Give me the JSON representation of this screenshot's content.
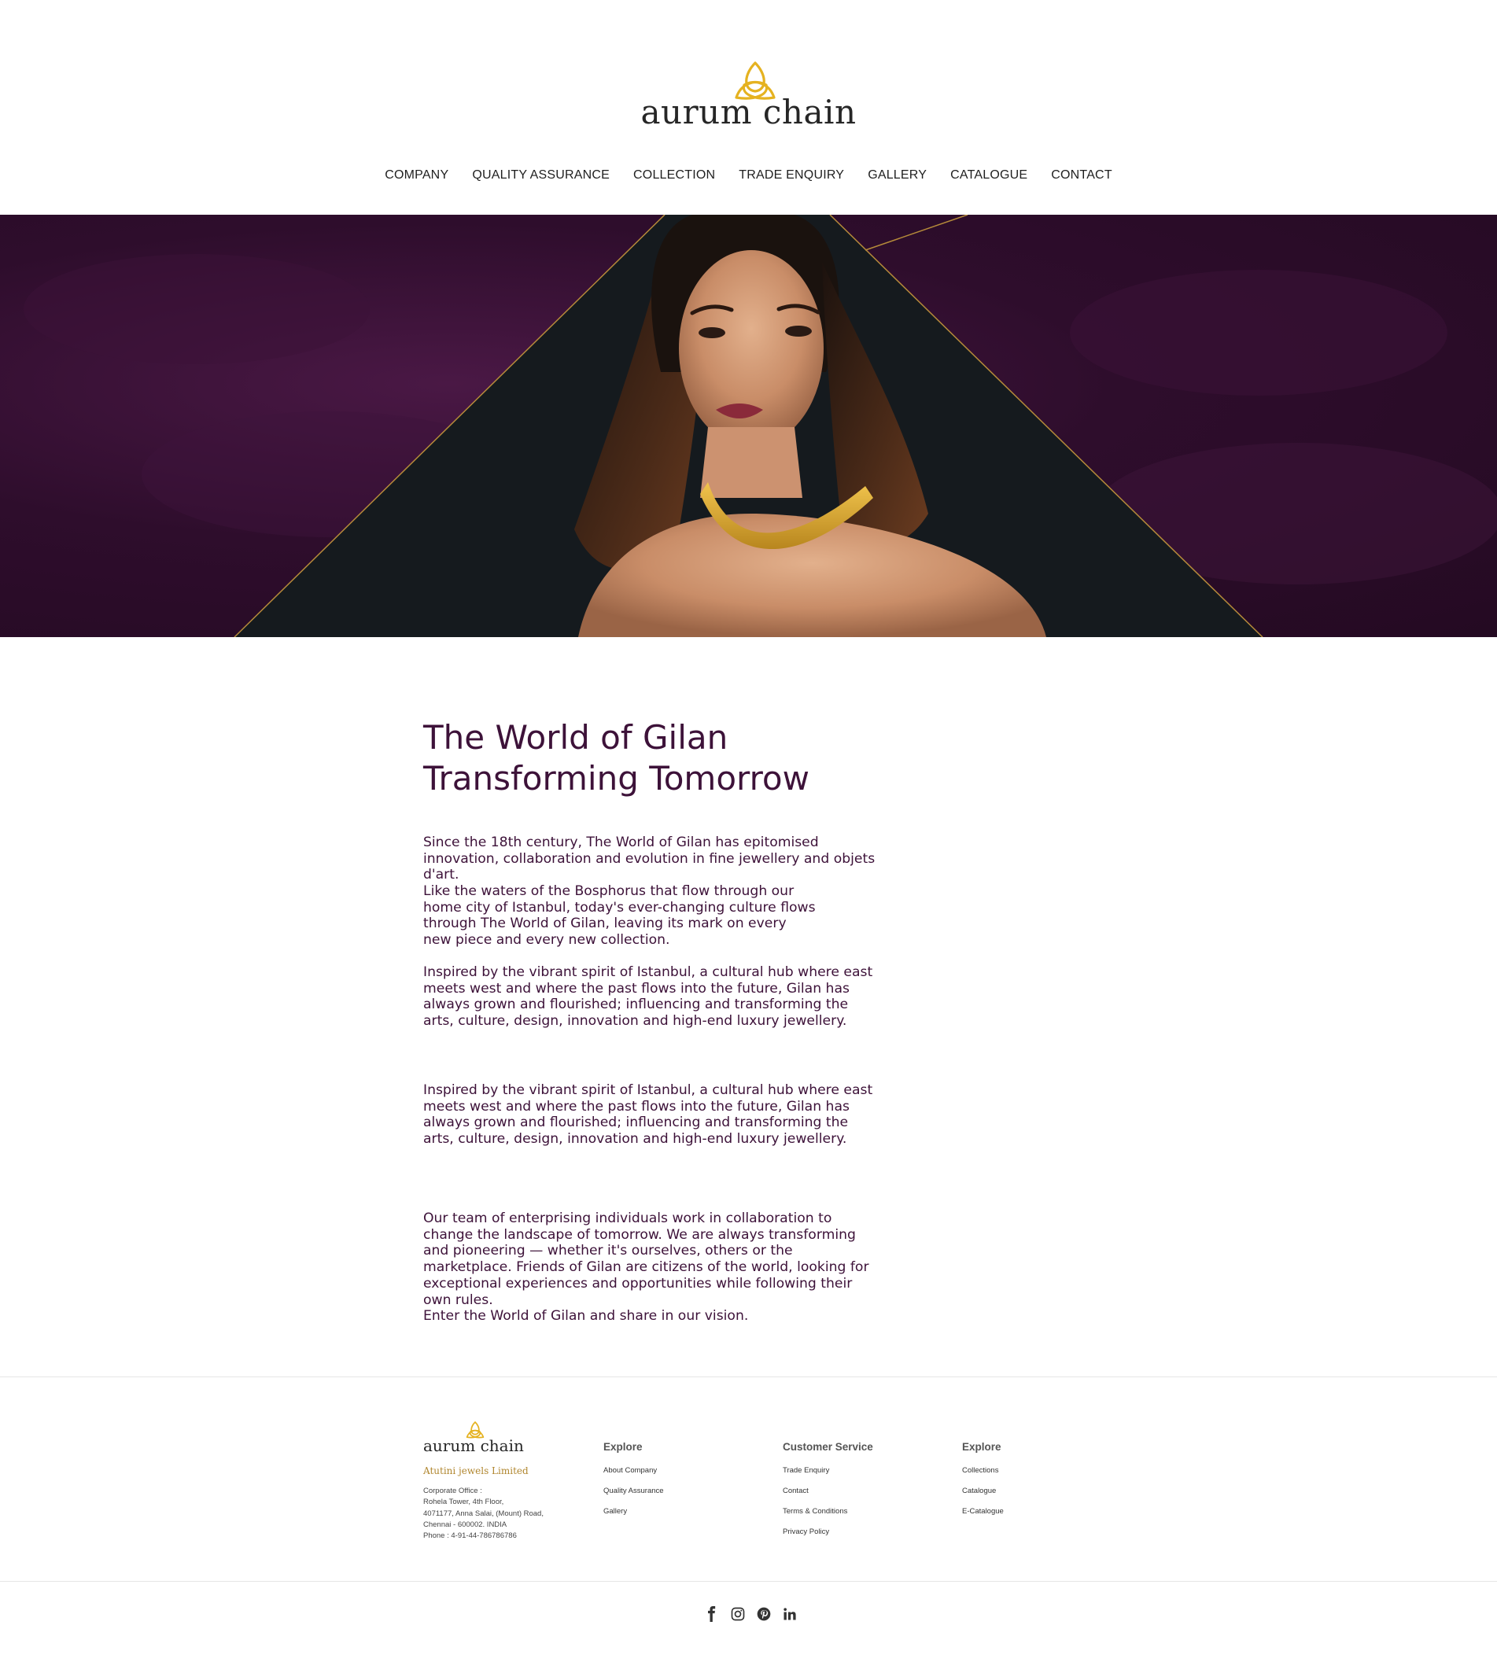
{
  "brand": {
    "name": "aurum chain",
    "icon": "trinity-knot-logo",
    "accent_color": "#e5b220"
  },
  "nav": {
    "items": [
      "COMPANY",
      "QUALITY ASSURANCE",
      "COLLECTION",
      "TRADE ENQUIRY",
      "GALLERY",
      "CATALOGUE",
      "CONTACT"
    ]
  },
  "hero": {
    "image": "model-wearing-gold-necklace",
    "background_color": "#2e0d2c"
  },
  "main": {
    "headline_line1": "The World of Gilan",
    "headline_line2": "Transforming Tomorrow",
    "paragraphs": [
      "Since the 18th century, The World of Gilan has epitomised innovation, collaboration and evolution in fine jewellery and objets d'art.",
      "Like the waters of the Bosphorus that flow through our home city of Istanbul, today's ever-changing culture flows through The World of Gilan, leaving its mark on every new piece and every new collection.",
      "Inspired by the vibrant spirit of Istanbul, a cultural hub where east meets west and where the past flows into the future, Gilan has always grown and flourished; influencing and transforming the arts, culture, design, innovation and high-end luxury jewellery.",
      "Inspired by the vibrant spirit of Istanbul, a cultural hub where east meets west and where the past flows into the future, Gilan has always grown and flourished; influencing and transforming the arts, culture, design, innovation and high-end luxury jewellery.",
      "Our team of enterprising individuals work in collaboration to change the landscape of tomorrow. We are always transforming and pioneering — whether it's ourselves, others or the marketplace. Friends of Gilan are citizens of the world, looking for exceptional experiences and opportunities while following their own rules.",
      "Enter the World of Gilan and share in our vision."
    ]
  },
  "footer": {
    "logo": "aurum chain",
    "company": "Atutini jewels Limited",
    "address": [
      "Corporate Office :",
      "Rohela Tower, 4th Floor,",
      "4071177, Anna Salai, (Mount) Road,",
      "Chennai - 600002. INDIA",
      "Phone : 4-91-44-786786786"
    ],
    "columns": [
      {
        "title": "Explore",
        "links": [
          "About Company",
          "Quality Assurance",
          "Gallery"
        ]
      },
      {
        "title": "Customer Service",
        "links": [
          "Trade Enquiry",
          "Contact",
          "Terms & Conditions",
          "Privacy Policy"
        ]
      },
      {
        "title": "Explore",
        "links": [
          "Collections",
          "Catalogue",
          "E-Catalogue"
        ]
      }
    ],
    "social": [
      "facebook-icon",
      "instagram-icon",
      "pinterest-icon",
      "linkedin-icon"
    ]
  }
}
